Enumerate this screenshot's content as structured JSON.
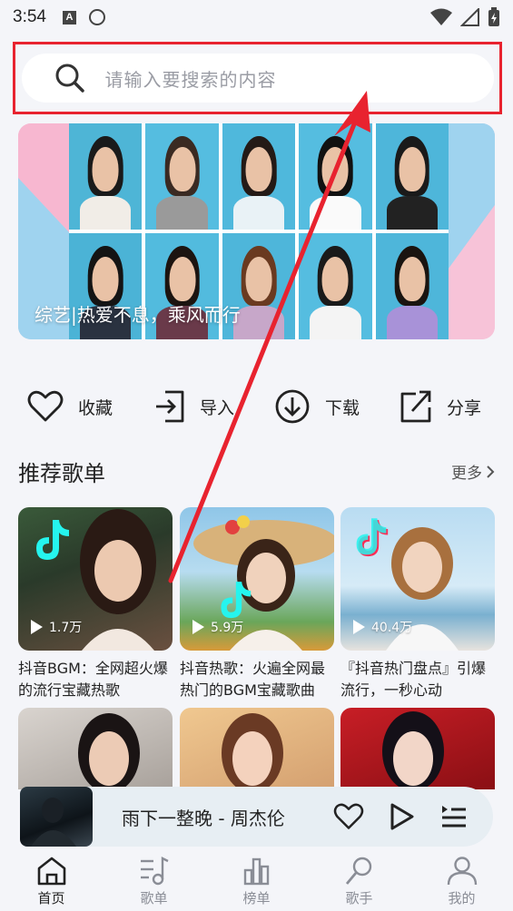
{
  "status_bar": {
    "time": "3:54",
    "a_badge": "A"
  },
  "search": {
    "placeholder": "请输入要搜索的内容"
  },
  "banner": {
    "caption": "综艺|热爱不息，乘风而行"
  },
  "actions": [
    {
      "label": "收藏",
      "icon": "heart-icon"
    },
    {
      "label": "导入",
      "icon": "import-icon"
    },
    {
      "label": "下载",
      "icon": "download-icon"
    },
    {
      "label": "分享",
      "icon": "share-icon"
    }
  ],
  "section": {
    "title": "推荐歌单",
    "more": "更多"
  },
  "playlists": [
    {
      "plays": "1.7万",
      "title": "抖音BGM：全网超火爆的流行宝藏热歌"
    },
    {
      "plays": "5.9万",
      "title": "抖音热歌：火遍全网最热门的BGM宝藏歌曲"
    },
    {
      "plays": "40.4万",
      "title": "『抖音热门盘点』引爆流行，一秒心动"
    }
  ],
  "player": {
    "title": "雨下一整晚 - 周杰伦"
  },
  "tabs": [
    {
      "label": "首页",
      "icon": "home-icon",
      "active": true
    },
    {
      "label": "歌单",
      "icon": "playlist-icon",
      "active": false
    },
    {
      "label": "榜单",
      "icon": "chart-icon",
      "active": false
    },
    {
      "label": "歌手",
      "icon": "singer-icon",
      "active": false
    },
    {
      "label": "我的",
      "icon": "profile-icon",
      "active": false
    }
  ],
  "colors": {
    "accent_red": "#e8232f",
    "background": "#f4f5f9",
    "player_bg": "#e7eef3"
  }
}
